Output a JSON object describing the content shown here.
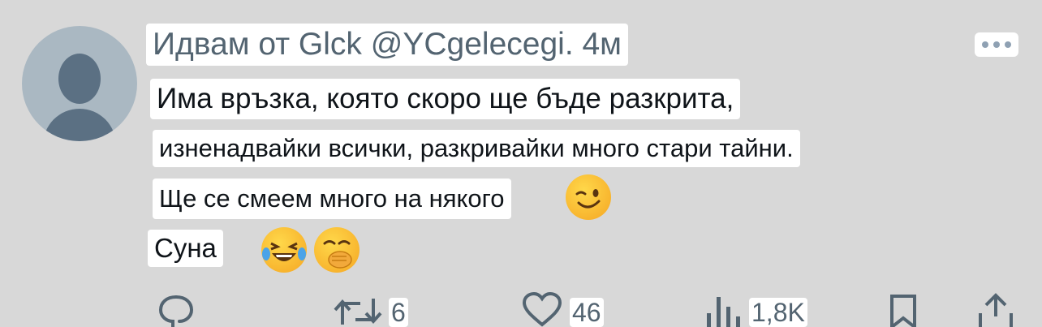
{
  "post": {
    "header": "Идвам от Glck @YCgelecegi. 4м",
    "lines": [
      "Има връзка, която скоро ще бъде разкрита,",
      "изненадвайки всички, разкривайки много стари тайни.",
      "Ще се смеем много на някого",
      "Суна"
    ]
  },
  "actions": {
    "reply_count": "",
    "retweet_count": "6",
    "like_count": "46",
    "views_count": "1,8K"
  },
  "icons": [
    "avatar",
    "more-icon",
    "wink-emoji",
    "laughing-emoji",
    "hand-over-mouth-emoji",
    "reply-icon",
    "retweet-icon",
    "like-icon",
    "views-icon",
    "bookmark-icon",
    "share-icon"
  ],
  "colors": {
    "background": "#d8d8d8",
    "muted": "#536471",
    "text": "#0f1419",
    "avatar_bg": "#aab8c2"
  }
}
